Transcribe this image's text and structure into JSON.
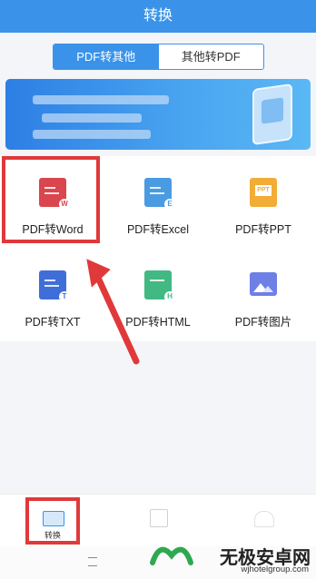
{
  "header": {
    "title": "转换"
  },
  "segment": {
    "active": "PDF转其他",
    "inactive": "其他转PDF"
  },
  "grid": [
    {
      "label": "PDF转Word",
      "icon": "word-icon",
      "color": "#d9464d",
      "badge": "W"
    },
    {
      "label": "PDF转Excel",
      "icon": "excel-icon",
      "color": "#4a9be2",
      "badge": "E"
    },
    {
      "label": "PDF转PPT",
      "icon": "ppt-icon",
      "color": "#f1ad36",
      "badge": "PPT"
    },
    {
      "label": "PDF转TXT",
      "icon": "txt-icon",
      "color": "#3f6ed8",
      "badge": "T"
    },
    {
      "label": "PDF转HTML",
      "icon": "html-icon",
      "color": "#42b983",
      "badge": "H"
    },
    {
      "label": "PDF转图片",
      "icon": "image-icon",
      "color": "#6e7fe6",
      "badge": ""
    }
  ],
  "tabbar": {
    "convert_label": "转换"
  },
  "watermark": {
    "brand": "无极安卓网",
    "url": "wjhotelgroup.com"
  },
  "colors": {
    "primary": "#3a93e8",
    "highlight": "#e0393a"
  }
}
